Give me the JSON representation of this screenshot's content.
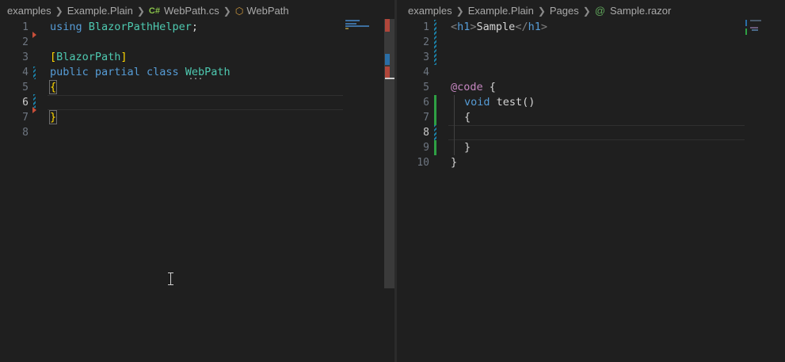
{
  "left_editor": {
    "breadcrumb": [
      "examples",
      "Example.Plain",
      "WebPath.cs",
      "WebPath"
    ],
    "file_icon": "C#",
    "line_numbers": [
      "1",
      "2",
      "3",
      "4",
      "5",
      "6",
      "7",
      "8"
    ],
    "active_line": "6",
    "code": {
      "l1_kw": "using",
      "l1_ns": "BlazorPathHelper",
      "l1_end": ";",
      "l3_open": "[",
      "l3_attr": "BlazorPath",
      "l3_close": "]",
      "l4_kw1": "public",
      "l4_kw2": "partial",
      "l4_kw3": "class",
      "l4_type": "WebPath",
      "l5_brace": "{",
      "l7_brace": "}"
    },
    "ellipsis": "..."
  },
  "right_editor": {
    "breadcrumb": [
      "examples",
      "Example.Plain",
      "Pages",
      "Sample.razor"
    ],
    "file_icon": "@",
    "line_numbers": [
      "1",
      "2",
      "3",
      "4",
      "5",
      "6",
      "7",
      "8",
      "9",
      "10"
    ],
    "active_line": "8",
    "code": {
      "l1_lt": "<",
      "l1_tag": "h1",
      "l1_gt": ">",
      "l1_text": "Sample",
      "l1_lt2": "</",
      "l1_tag2": "h1",
      "l1_gt2": ">",
      "l5_at": "@code",
      "l5_brace": " {",
      "l6_kw": "void",
      "l6_name": " test()",
      "l7_brace": "{",
      "l9_brace": "}",
      "l10_brace": "}"
    }
  },
  "icons": {
    "breadcrumb_separator": "chevron-right-icon",
    "symbol": "class-symbol-icon",
    "cursor": "text-cursor-icon"
  },
  "colors": {
    "background": "#1f1f1f",
    "keyword": "#569cd6",
    "type": "#4ec9b0",
    "bracket": "#ffd700",
    "diff_added": "#2ea043",
    "diff_modified": "#1b81a8",
    "diff_deleted": "#c74e39"
  }
}
